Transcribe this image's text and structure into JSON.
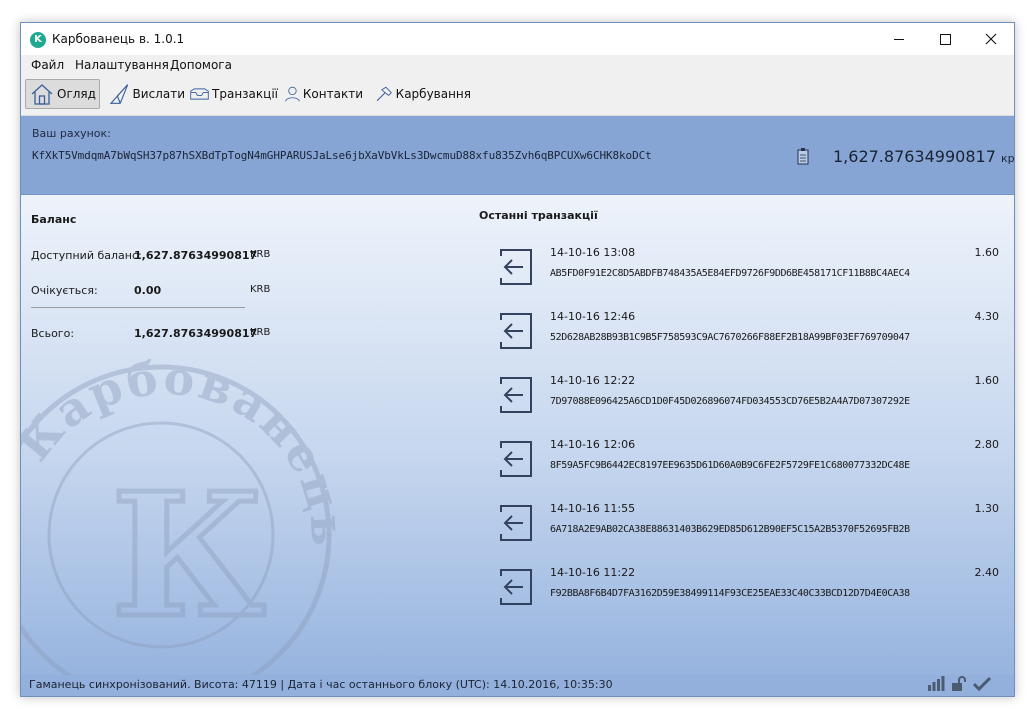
{
  "window": {
    "title": "Карбованець в. 1.0.1",
    "app_icon_letter": "K"
  },
  "menu": {
    "file": "Файл",
    "settings": "Налаштування",
    "help": "Допомога"
  },
  "toolbar": {
    "overview": "Огляд",
    "send": "Вислати",
    "transactions": "Транзакції",
    "contacts": "Контакти",
    "mining": "Карбування"
  },
  "account": {
    "label": "Ваш рахунок:",
    "address": "KfXkT5VmdqmA7bWqSH37p87hSXBdTpTogN4mGHPARUSJaLse6jbXaVbVkLs3DwcmuD88xfu835Zvh6qBPCUXw6CHK8koDCt",
    "balance": "1,627.87634990817",
    "balance_unit": "крб."
  },
  "balance": {
    "title": "Баланс",
    "available_label": "Доступний баланс:",
    "available_value": "1,627.87634990817",
    "available_unit": "KRB",
    "pending_label": "Очікується:",
    "pending_value": "0.00",
    "pending_unit": "KRB",
    "total_label": "Всього:",
    "total_value": "1,627.87634990817",
    "total_unit": "KRB"
  },
  "recent": {
    "title": "Останні транзакції",
    "items": [
      {
        "date": "14-10-16 13:08",
        "amount": "1.60",
        "hash": "AB5FD0F91E2C8D5ABDFB748435A5E84EFD9726F9DD6BE458171CF11B8BC4AEC4"
      },
      {
        "date": "14-10-16 12:46",
        "amount": "4.30",
        "hash": "52D628AB28B93B1C9B5F758593C9AC7670266F88EF2B18A99BF03EF769709047"
      },
      {
        "date": "14-10-16 12:22",
        "amount": "1.60",
        "hash": "7D97088E096425A6CD1D0F45D026896074FD034553CD76E5B2A4A7D07307292E"
      },
      {
        "date": "14-10-16 12:06",
        "amount": "2.80",
        "hash": "8F59A5FC9B6442EC8197EE9635D61D60A0B9C6FE2F5729FE1C680077332DC48E"
      },
      {
        "date": "14-10-16 11:55",
        "amount": "1.30",
        "hash": "6A718A2E9AB02CA38E88631403B629ED85D612B90EF5C15A2B5370F52695FB2B"
      },
      {
        "date": "14-10-16 11:22",
        "amount": "2.40",
        "hash": "F92BBA8F6B4D7FA3162D59E38499114F93CE25EAE33C40C33BCD12D7D4E0CA38"
      }
    ]
  },
  "watermark": {
    "text": "Карбованець",
    "letter": "К"
  },
  "status": {
    "text": "Гаманець синхронізований. Висота: 47119  |  Дата і час останнього блоку (UTC): 14.10.2016, 10:35:30",
    "icons": [
      "network-bars-icon",
      "unlocked-padlock-icon",
      "checkmark-icon"
    ]
  },
  "colors": {
    "account_bar": "#87a5d4",
    "status_bar": "#93b0dc",
    "gradient_bottom": "#97b4df",
    "app_icon": "#1eaa8e"
  }
}
